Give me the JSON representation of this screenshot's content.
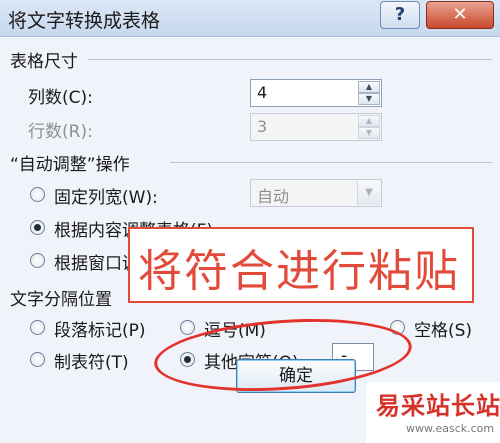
{
  "window": {
    "title": "将文字转换成表格",
    "help_label": "?",
    "close_label": "✕"
  },
  "table_size": {
    "group_title": "表格尺寸",
    "columns_label": "列数(C):",
    "columns_value": "4",
    "rows_label": "行数(R):",
    "rows_value": "3"
  },
  "autofit": {
    "group_title": "“自动调整”操作",
    "fixed_width_label": "固定列宽(W):",
    "fixed_width_value": "自动",
    "content_label": "根据内容调整表格(F)",
    "window_label": "根据窗口调整表格(D)"
  },
  "separator": {
    "group_title": "文字分隔位置",
    "paragraph_label": "段落标记(P)",
    "comma_label": "逗号(M)",
    "space_label": "空格(S)",
    "tab_label": "制表符(T)",
    "other_label": "其他字符(O):",
    "other_value": "-"
  },
  "buttons": {
    "ok_label": "确定"
  },
  "annotation": {
    "text": "将符合进行粘贴"
  },
  "watermark": {
    "top": "易采站长站",
    "bottom": "www.easck.com"
  },
  "colors": {
    "annotation_red": "#e24a3a",
    "close_red": "#c8472c",
    "ok_border": "#3c7fb1"
  }
}
